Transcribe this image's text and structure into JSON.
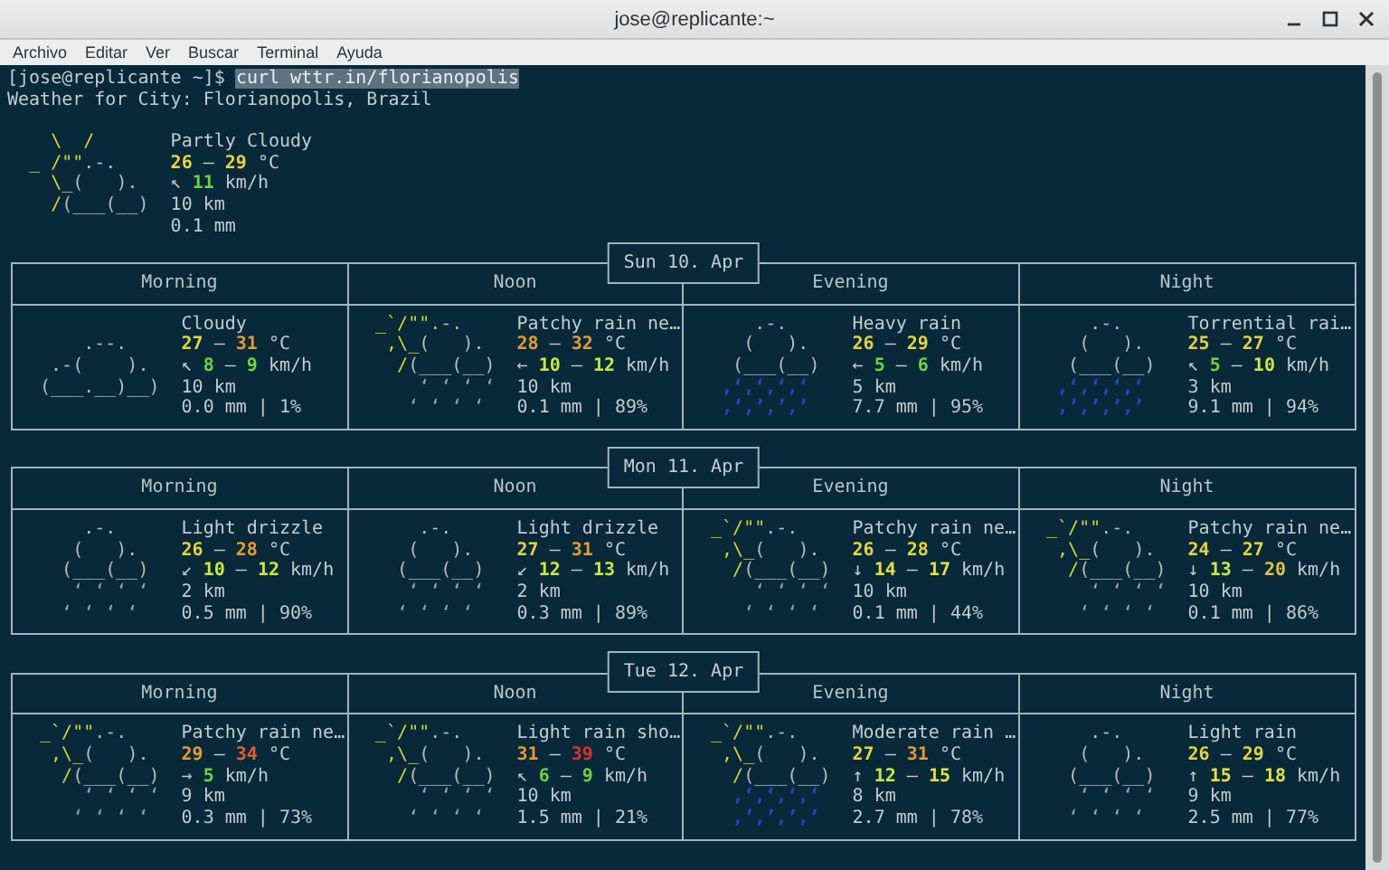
{
  "window": {
    "title": "jose@replicante:~"
  },
  "menu": [
    "Archivo",
    "Editar",
    "Ver",
    "Buscar",
    "Terminal",
    "Ayuda"
  ],
  "prompt": {
    "text": "[jose@replicante ~]$ ",
    "command": "curl wttr.in/florianopolis",
    "selected": true
  },
  "location": "Weather for City: Florianopolis, Brazil",
  "current": {
    "art": [
      [
        {
          "text": "   \\  /",
          "kind": "sun"
        }
      ],
      [
        {
          "text": " _ /\"\"",
          "kind": "sun"
        },
        {
          "text": ".-.",
          "kind": "cloud"
        }
      ],
      [
        {
          "text": "   \\_",
          "kind": "sun"
        },
        {
          "text": "(   ).",
          "kind": "cloud"
        }
      ],
      [
        {
          "text": "   /",
          "kind": "sun"
        },
        {
          "text": "(___(__)",
          "kind": "cloud"
        }
      ]
    ],
    "condition": "Partly Cloudy",
    "temperature": [
      {
        "text": "26",
        "color": "#e4d43a"
      },
      {
        "text": " – "
      },
      {
        "text": "29",
        "color": "#e4d43a"
      },
      {
        "text": " °C"
      }
    ],
    "wind": [
      {
        "text": "↖ "
      },
      {
        "text": "11",
        "color": "#6cd43c"
      },
      {
        "text": " km/h"
      }
    ],
    "visibility": "10 km",
    "precipitation": "0.1 mm"
  },
  "days": [
    {
      "label": "Sun 10. Apr",
      "slots": [
        {
          "period": "Morning",
          "art": [
            [
              {
                "text": "     .--.",
                "kind": "cloud"
              }
            ],
            [
              {
                "text": "  .-(    ).",
                "kind": "cloud"
              }
            ],
            [
              {
                "text": " (___.__)__)",
                "kind": "cloud"
              }
            ]
          ],
          "condition": "Cloudy",
          "temperature": [
            {
              "text": "27",
              "color": "#e4d43a"
            },
            {
              "text": " – "
            },
            {
              "text": "31",
              "color": "#e89a2e"
            },
            {
              "text": " °C"
            }
          ],
          "wind": [
            {
              "text": "↖ "
            },
            {
              "text": "8",
              "color": "#6cd43c"
            },
            {
              "text": " – "
            },
            {
              "text": "9",
              "color": "#6cd43c"
            },
            {
              "text": " km/h"
            }
          ],
          "visibility": "10 km",
          "precipitation": "0.0 mm | 1%"
        },
        {
          "period": "Noon",
          "art": [
            [
              {
                "text": " _`/\"\"",
                "kind": "sun"
              },
              {
                "text": ".-.",
                "kind": "cloud"
              }
            ],
            [
              {
                "text": "  ,\\_",
                "kind": "sun"
              },
              {
                "text": "(   ).",
                "kind": "cloud"
              }
            ],
            [
              {
                "text": "   /",
                "kind": "sun"
              },
              {
                "text": "(___(__)",
                "kind": "cloud"
              }
            ],
            [
              {
                "text": "     ‘ ‘ ‘ ‘",
                "kind": "drizzle"
              }
            ],
            [
              {
                "text": "    ‘ ‘ ‘ ‘",
                "kind": "drizzle"
              }
            ]
          ],
          "condition": "Patchy rain ne…",
          "temperature": [
            {
              "text": "28",
              "color": "#e89a2e"
            },
            {
              "text": " – "
            },
            {
              "text": "32",
              "color": "#e89a2e"
            },
            {
              "text": " °C"
            }
          ],
          "wind": [
            {
              "text": "← "
            },
            {
              "text": "10",
              "color": "#cce83a"
            },
            {
              "text": " – "
            },
            {
              "text": "12",
              "color": "#cce83a"
            },
            {
              "text": " km/h"
            }
          ],
          "visibility": "10 km",
          "precipitation": "0.1 mm | 89%"
        },
        {
          "period": "Evening",
          "art": [
            [
              {
                "text": "     .-.",
                "kind": "cloud"
              }
            ],
            [
              {
                "text": "    (   ).",
                "kind": "cloud"
              }
            ],
            [
              {
                "text": "   (___(__)",
                "kind": "cloud"
              }
            ],
            [
              {
                "text": "  ‚‘‚‘‚‘‚‘",
                "kind": "heavy"
              }
            ],
            [
              {
                "text": "  ‚’‚’‚’‚’",
                "kind": "heavy"
              }
            ]
          ],
          "condition": "Heavy rain",
          "temperature": [
            {
              "text": "26",
              "color": "#e4d43a"
            },
            {
              "text": " – "
            },
            {
              "text": "29",
              "color": "#e4d43a"
            },
            {
              "text": " °C"
            }
          ],
          "wind": [
            {
              "text": "← "
            },
            {
              "text": "5",
              "color": "#6cd43c"
            },
            {
              "text": " – "
            },
            {
              "text": "6",
              "color": "#6cd43c"
            },
            {
              "text": " km/h"
            }
          ],
          "visibility": "5 km",
          "precipitation": "7.7 mm | 95%"
        },
        {
          "period": "Night",
          "art": [
            [
              {
                "text": "     .-.",
                "kind": "cloud"
              }
            ],
            [
              {
                "text": "    (   ).",
                "kind": "cloud"
              }
            ],
            [
              {
                "text": "   (___(__)",
                "kind": "cloud"
              }
            ],
            [
              {
                "text": "  ‚‘‚‘‚‘‚‘",
                "kind": "heavy"
              }
            ],
            [
              {
                "text": "  ‚’‚’‚’‚’",
                "kind": "heavy"
              }
            ]
          ],
          "condition": "Torrential rai…",
          "temperature": [
            {
              "text": "25",
              "color": "#e4d43a"
            },
            {
              "text": " – "
            },
            {
              "text": "27",
              "color": "#e4d43a"
            },
            {
              "text": " °C"
            }
          ],
          "wind": [
            {
              "text": "↖ "
            },
            {
              "text": "5",
              "color": "#6cd43c"
            },
            {
              "text": " – "
            },
            {
              "text": "10",
              "color": "#cce83a"
            },
            {
              "text": " km/h"
            }
          ],
          "visibility": "3 km",
          "precipitation": "9.1 mm | 94%"
        }
      ]
    },
    {
      "label": "Mon 11. Apr",
      "slots": [
        {
          "period": "Morning",
          "art": [
            [
              {
                "text": "     .-.",
                "kind": "cloud"
              }
            ],
            [
              {
                "text": "    (   ).",
                "kind": "cloud"
              }
            ],
            [
              {
                "text": "   (___(__)",
                "kind": "cloud"
              }
            ],
            [
              {
                "text": "    ‘ ‘ ‘ ‘",
                "kind": "drizzle"
              }
            ],
            [
              {
                "text": "   ‘ ‘ ‘ ‘",
                "kind": "drizzle"
              }
            ]
          ],
          "condition": "Light drizzle",
          "temperature": [
            {
              "text": "26",
              "color": "#e4d43a"
            },
            {
              "text": " – "
            },
            {
              "text": "28",
              "color": "#e89a2e"
            },
            {
              "text": " °C"
            }
          ],
          "wind": [
            {
              "text": "↙ "
            },
            {
              "text": "10",
              "color": "#cce83a"
            },
            {
              "text": " – "
            },
            {
              "text": "12",
              "color": "#cce83a"
            },
            {
              "text": " km/h"
            }
          ],
          "visibility": "2 km",
          "precipitation": "0.5 mm | 90%"
        },
        {
          "period": "Noon",
          "art": [
            [
              {
                "text": "     .-.",
                "kind": "cloud"
              }
            ],
            [
              {
                "text": "    (   ).",
                "kind": "cloud"
              }
            ],
            [
              {
                "text": "   (___(__)",
                "kind": "cloud"
              }
            ],
            [
              {
                "text": "    ‘ ‘ ‘ ‘",
                "kind": "drizzle"
              }
            ],
            [
              {
                "text": "   ‘ ‘ ‘ ‘",
                "kind": "drizzle"
              }
            ]
          ],
          "condition": "Light drizzle",
          "temperature": [
            {
              "text": "27",
              "color": "#e4d43a"
            },
            {
              "text": " – "
            },
            {
              "text": "31",
              "color": "#e89a2e"
            },
            {
              "text": " °C"
            }
          ],
          "wind": [
            {
              "text": "↙ "
            },
            {
              "text": "12",
              "color": "#cce83a"
            },
            {
              "text": " – "
            },
            {
              "text": "13",
              "color": "#cce83a"
            },
            {
              "text": " km/h"
            }
          ],
          "visibility": "2 km",
          "precipitation": "0.3 mm | 89%"
        },
        {
          "period": "Evening",
          "art": [
            [
              {
                "text": " _`/\"\"",
                "kind": "sun"
              },
              {
                "text": ".-.",
                "kind": "cloud"
              }
            ],
            [
              {
                "text": "  ,\\_",
                "kind": "sun"
              },
              {
                "text": "(   ).",
                "kind": "cloud"
              }
            ],
            [
              {
                "text": "   /",
                "kind": "sun"
              },
              {
                "text": "(___(__)",
                "kind": "cloud"
              }
            ],
            [
              {
                "text": "     ‘ ‘ ‘ ‘",
                "kind": "drizzle"
              }
            ],
            [
              {
                "text": "    ‘ ‘ ‘ ‘",
                "kind": "drizzle"
              }
            ]
          ],
          "condition": "Patchy rain ne…",
          "temperature": [
            {
              "text": "26",
              "color": "#e4d43a"
            },
            {
              "text": " – "
            },
            {
              "text": "28",
              "color": "#e4d43a"
            },
            {
              "text": " °C"
            }
          ],
          "wind": [
            {
              "text": "↓ "
            },
            {
              "text": "14",
              "color": "#e4e23a"
            },
            {
              "text": " – "
            },
            {
              "text": "17",
              "color": "#e4e23a"
            },
            {
              "text": " km/h"
            }
          ],
          "visibility": "10 km",
          "precipitation": "0.1 mm | 44%"
        },
        {
          "period": "Night",
          "art": [
            [
              {
                "text": " _`/\"\"",
                "kind": "sun"
              },
              {
                "text": ".-.",
                "kind": "cloud"
              }
            ],
            [
              {
                "text": "  ,\\_",
                "kind": "sun"
              },
              {
                "text": "(   ).",
                "kind": "cloud"
              }
            ],
            [
              {
                "text": "   /",
                "kind": "sun"
              },
              {
                "text": "(___(__)",
                "kind": "cloud"
              }
            ],
            [
              {
                "text": "     ‘ ‘ ‘ ‘",
                "kind": "drizzle"
              }
            ],
            [
              {
                "text": "    ‘ ‘ ‘ ‘",
                "kind": "drizzle"
              }
            ]
          ],
          "condition": "Patchy rain ne…",
          "temperature": [
            {
              "text": "24",
              "color": "#e4d43a"
            },
            {
              "text": " – "
            },
            {
              "text": "27",
              "color": "#e4d43a"
            },
            {
              "text": " °C"
            }
          ],
          "wind": [
            {
              "text": "↓ "
            },
            {
              "text": "13",
              "color": "#cce83a"
            },
            {
              "text": " – "
            },
            {
              "text": "20",
              "color": "#e4c43a"
            },
            {
              "text": " km/h"
            }
          ],
          "visibility": "10 km",
          "precipitation": "0.1 mm | 86%"
        }
      ]
    },
    {
      "label": "Tue 12. Apr",
      "slots": [
        {
          "period": "Morning",
          "art": [
            [
              {
                "text": " _`/\"\"",
                "kind": "sun"
              },
              {
                "text": ".-.",
                "kind": "cloud"
              }
            ],
            [
              {
                "text": "  ,\\_",
                "kind": "sun"
              },
              {
                "text": "(   ).",
                "kind": "cloud"
              }
            ],
            [
              {
                "text": "   /",
                "kind": "sun"
              },
              {
                "text": "(___(__)",
                "kind": "cloud"
              }
            ],
            [
              {
                "text": "     ‘ ‘ ‘ ‘",
                "kind": "drizzle"
              }
            ],
            [
              {
                "text": "    ‘ ‘ ‘ ‘",
                "kind": "drizzle"
              }
            ]
          ],
          "condition": "Patchy rain ne…",
          "temperature": [
            {
              "text": "29",
              "color": "#e89a2e"
            },
            {
              "text": " – "
            },
            {
              "text": "34",
              "color": "#e0602c"
            },
            {
              "text": " °C"
            }
          ],
          "wind": [
            {
              "text": "→ "
            },
            {
              "text": "5",
              "color": "#6cd43c"
            },
            {
              "text": " km/h"
            }
          ],
          "visibility": "9 km",
          "precipitation": "0.3 mm | 73%"
        },
        {
          "period": "Noon",
          "art": [
            [
              {
                "text": " _`/\"\"",
                "kind": "sun"
              },
              {
                "text": ".-.",
                "kind": "cloud"
              }
            ],
            [
              {
                "text": "  ,\\_",
                "kind": "sun"
              },
              {
                "text": "(   ).",
                "kind": "cloud"
              }
            ],
            [
              {
                "text": "   /",
                "kind": "sun"
              },
              {
                "text": "(___(__)",
                "kind": "cloud"
              }
            ],
            [
              {
                "text": "     ‘ ‘ ‘ ‘",
                "kind": "drizzle"
              }
            ],
            [
              {
                "text": "    ‘ ‘ ‘ ‘",
                "kind": "drizzle"
              }
            ]
          ],
          "condition": "Light rain sho…",
          "temperature": [
            {
              "text": "31",
              "color": "#e89a2e"
            },
            {
              "text": " – "
            },
            {
              "text": "39",
              "color": "#e03030"
            },
            {
              "text": " °C"
            }
          ],
          "wind": [
            {
              "text": "↖ "
            },
            {
              "text": "6",
              "color": "#6cd43c"
            },
            {
              "text": " – "
            },
            {
              "text": "9",
              "color": "#6cd43c"
            },
            {
              "text": " km/h"
            }
          ],
          "visibility": "10 km",
          "precipitation": "1.5 mm | 21%"
        },
        {
          "period": "Evening",
          "art": [
            [
              {
                "text": " _`/\"\"",
                "kind": "sun"
              },
              {
                "text": ".-.",
                "kind": "cloud"
              }
            ],
            [
              {
                "text": "  ,\\_",
                "kind": "sun"
              },
              {
                "text": "(   ).",
                "kind": "cloud"
              }
            ],
            [
              {
                "text": "   /",
                "kind": "sun"
              },
              {
                "text": "(___(__)",
                "kind": "cloud"
              }
            ],
            [
              {
                "text": "   ‚‘‚‘‚‘‚‘",
                "kind": "heavy"
              }
            ],
            [
              {
                "text": "   ‚’‚’‚’‚’",
                "kind": "heavy"
              }
            ]
          ],
          "condition": "Moderate rain …",
          "temperature": [
            {
              "text": "27",
              "color": "#e4d43a"
            },
            {
              "text": " – "
            },
            {
              "text": "31",
              "color": "#e89a2e"
            },
            {
              "text": " °C"
            }
          ],
          "wind": [
            {
              "text": "↑ "
            },
            {
              "text": "12",
              "color": "#cce83a"
            },
            {
              "text": " – "
            },
            {
              "text": "15",
              "color": "#e4e23a"
            },
            {
              "text": " km/h"
            }
          ],
          "visibility": "8 km",
          "precipitation": "2.7 mm | 78%"
        },
        {
          "period": "Night",
          "art": [
            [
              {
                "text": "     .-.",
                "kind": "cloud"
              }
            ],
            [
              {
                "text": "    (   ).",
                "kind": "cloud"
              }
            ],
            [
              {
                "text": "   (___(__)",
                "kind": "cloud"
              }
            ],
            [
              {
                "text": "    ‘ ‘ ‘ ‘",
                "kind": "drizzle"
              }
            ],
            [
              {
                "text": "   ‘ ‘ ‘ ‘",
                "kind": "drizzle"
              }
            ]
          ],
          "condition": "Light rain",
          "temperature": [
            {
              "text": "26",
              "color": "#e4d43a"
            },
            {
              "text": " – "
            },
            {
              "text": "29",
              "color": "#e4d43a"
            },
            {
              "text": " °C"
            }
          ],
          "wind": [
            {
              "text": "↑ "
            },
            {
              "text": "15",
              "color": "#e4e23a"
            },
            {
              "text": " – "
            },
            {
              "text": "18",
              "color": "#e4e23a"
            },
            {
              "text": " km/h"
            }
          ],
          "visibility": "9 km",
          "precipitation": "2.5 mm | 77%"
        }
      ]
    }
  ]
}
